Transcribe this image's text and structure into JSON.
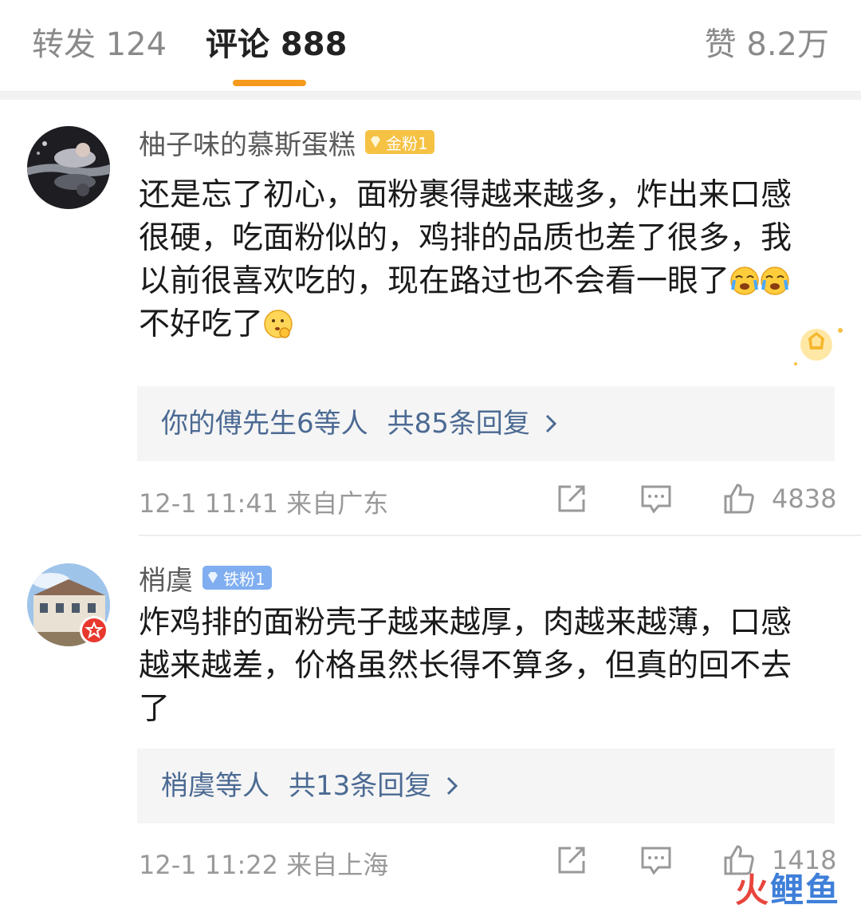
{
  "tabs": {
    "forward_label": "转发 124",
    "comments_label": "评论 888",
    "likes_label": "赞 8.2万",
    "active_color": "#f59a1b"
  },
  "comments": [
    {
      "username": "柚子味的慕斯蛋糕",
      "badge": "金粉1",
      "text_before": "还是忘了初心，面粉裹得越来越多，炸出来口感很硬，吃面粉似的，鸡排的品质也差了很多，我以前很喜欢吃的，现在路过也不会看一眼了",
      "emoji_1": "cry-emoji",
      "text_middle": "不好吃了",
      "emoji_2": "think-emoji",
      "reply_names": "你的傅先生6等人",
      "reply_count": "共85条回复",
      "timestamp": "12-1 11:41  来自广东",
      "like_count": "4838"
    },
    {
      "username": "梢虞",
      "badge": "铁粉1",
      "text": "炸鸡排的面粉壳子越来越厚，肉越来越薄，口感越来越差，价格虽然长得不算多，但真的回不去了",
      "reply_names": "梢虞等人",
      "reply_count": "共13条回复",
      "timestamp": "12-1 11:22  来自上海",
      "like_count": "1418"
    }
  ],
  "watermark": {
    "part1": "火",
    "part2": "鲤鱼"
  },
  "colors": {
    "reply_link": "#4b6a93",
    "badge_gold": "#f6c244",
    "badge_iron": "#80aef0"
  }
}
